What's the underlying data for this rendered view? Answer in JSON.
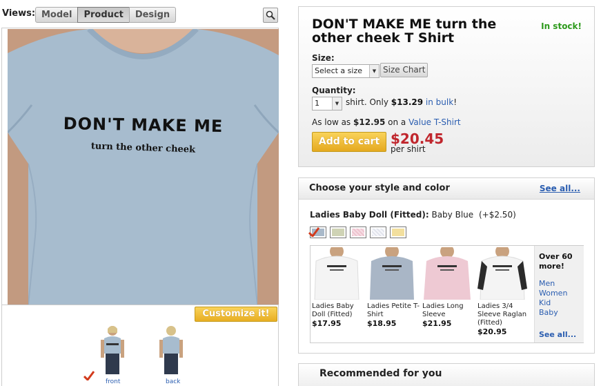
{
  "views": {
    "label": "Views:",
    "tabs": [
      "Model",
      "Product",
      "Design"
    ],
    "active_tab": "Product"
  },
  "shirt_print": {
    "line1": "DON'T MAKE ME",
    "line2": "turn the other cheek"
  },
  "customize": {
    "label": "Customize it!"
  },
  "thumbs": [
    {
      "label": "front",
      "selected": true
    },
    {
      "label": "back",
      "selected": false
    }
  ],
  "product": {
    "title": "DON'T MAKE ME turn the other cheek T Shirt",
    "stock": "In stock!",
    "size_label": "Size:",
    "size_select": "Select a size",
    "size_chart": "Size Chart",
    "qty_label": "Quantity:",
    "qty_value": "1",
    "qty_text_pre": "shirt. Only",
    "bulk_price": "$13.29",
    "bulk_link": "in bulk",
    "bulk_post": "!",
    "aslow_pre": "As low as",
    "aslow_price": "$12.95",
    "aslow_mid": "on a",
    "aslow_link": "Value T-Shirt",
    "add_to_cart": "Add to cart",
    "price": "$20.45",
    "per_shirt": "per shirt"
  },
  "style": {
    "title": "Choose your style and color",
    "see_all": "See all...",
    "current_name": "Ladies Baby Doll (Fitted):",
    "current_color": "Baby Blue",
    "current_upcharge": "(+$2.50)",
    "swatches": [
      {
        "name": "Baby Blue",
        "color": "#a9b9c9",
        "selected": true
      },
      {
        "name": "Khaki",
        "color": "#cfd3b5",
        "selected": false
      },
      {
        "name": "Pink",
        "color": "#eec4cf",
        "selected": false
      },
      {
        "name": "White",
        "color": "#e6e8f0",
        "selected": false
      },
      {
        "name": "Yellow",
        "color": "#f2df9e",
        "selected": false
      }
    ],
    "items": [
      {
        "name": "Ladies Baby Doll (Fitted)",
        "price": "$17.95",
        "shirt_color": "#f4f4f4"
      },
      {
        "name": "Ladies Petite T-Shirt",
        "price": "$18.95",
        "shirt_color": "#a9b6c6"
      },
      {
        "name": "Ladies Long Sleeve",
        "price": "$21.95",
        "shirt_color": "#eec9d3"
      },
      {
        "name": "Ladies 3/4 Sleeve Raglan (Fitted)",
        "price": "$20.95",
        "shirt_color": "#f4f4f4"
      }
    ],
    "more": {
      "title": "Over 60 more!",
      "links": [
        "Men",
        "Women",
        "Kid",
        "Baby"
      ],
      "see_all": "See all..."
    }
  },
  "recommended": {
    "title": "Recommended for you"
  },
  "colors": {
    "shirt": "#a7bcce",
    "accent_gold": "#f0bd3a",
    "price_red": "#c0262d",
    "stock_green": "#2d9a1c",
    "link_blue": "#2a5db0"
  }
}
